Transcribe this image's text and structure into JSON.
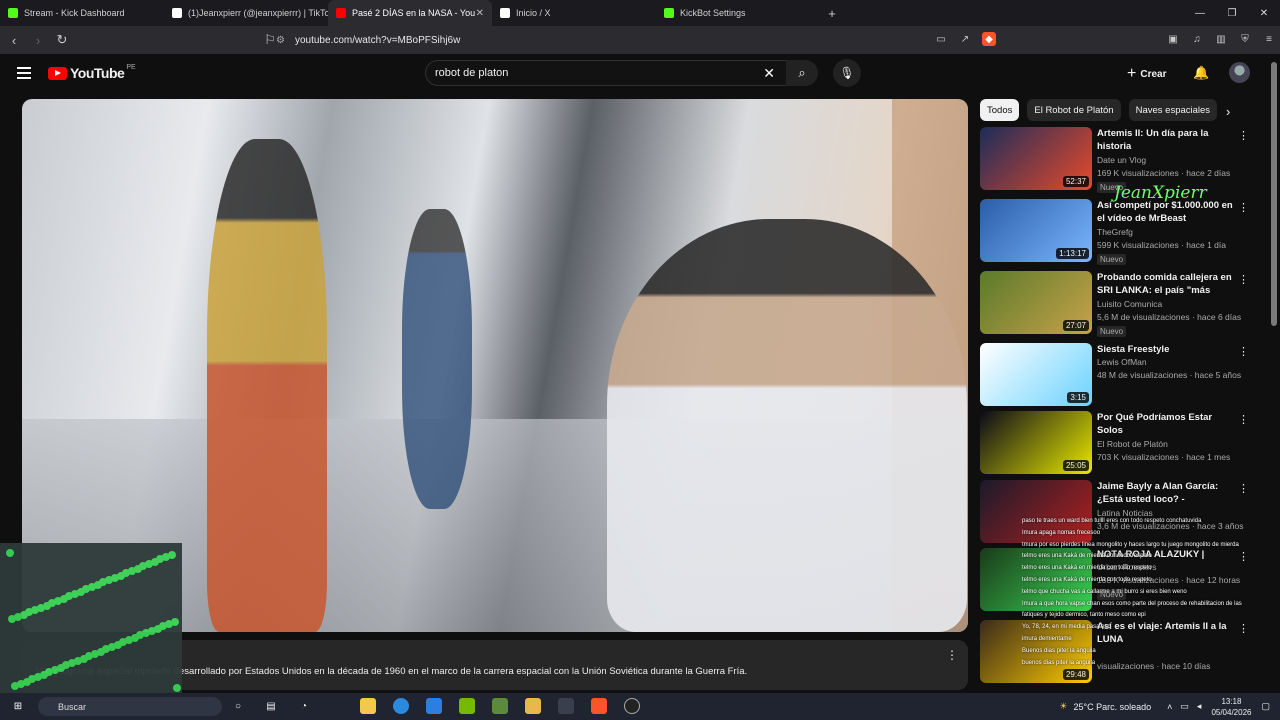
{
  "browser": {
    "tabs": [
      {
        "label": "Stream - Kick Dashboard",
        "color": "#53fc18",
        "active": false
      },
      {
        "label": "(1)Jeanxpierr (@jeanxpierrr) | TikTok",
        "color": "#ffffff",
        "active": false
      },
      {
        "label": "Pasé 2 DÍAS en la NASA - You",
        "color": "#ff0000",
        "active": true
      },
      {
        "label": "Inicio / X",
        "color": "#ffffff",
        "active": false
      },
      {
        "label": "KickBot Settings",
        "color": "#53fc18",
        "active": false
      }
    ],
    "new_tab": "+",
    "url": "youtube.com/watch?v=MBoPFSihj6w",
    "window_controls": [
      "—",
      "❐",
      "✕"
    ]
  },
  "youtube": {
    "logo_text": "YouTube",
    "country": "PE",
    "search_value": "robot de platon",
    "create_label": "Crear"
  },
  "watermark": "JeanXpierr",
  "caption": "Viki       programa espacial tripulado desarrollado por Estados Unidos en la década de 1960 en el marco de la carrera espacial con la Unión Soviética durante la Guerra Fría.",
  "chips": [
    "Todos",
    "El Robot de Platón",
    "Naves espaciales"
  ],
  "recommendations": [
    {
      "title": "Artemis II: Un día para la historia",
      "channel": "Date un Vlog",
      "meta": "169 K visualizaciones · hace 2 días",
      "badge": "Nuevo",
      "duration": "52:37",
      "colors": [
        "#1c2c5a",
        "#e84a2a"
      ]
    },
    {
      "title": "Así competí por $1.000.000 en el vídeo de MrBeast",
      "channel": "TheGrefg",
      "meta": "599 K visualizaciones · hace 1 día",
      "badge": "Nuevo",
      "duration": "1:13:17",
      "colors": [
        "#2a5da8",
        "#7bb6ff"
      ]
    },
    {
      "title": "Probando comida callejera en SRI LANKA: el país \"más barat...",
      "channel": "Luisito Comunica",
      "meta": "5,6 M de visualizaciones · hace 6 días",
      "badge": "Nuevo",
      "duration": "27:07",
      "colors": [
        "#5a7a2a",
        "#c8a24a"
      ]
    },
    {
      "title": "Siesta Freestyle",
      "channel": "Lewis OfMan",
      "meta": "48 M de visualizaciones · hace 5 años",
      "badge": "",
      "duration": "3:15",
      "colors": [
        "#ffffff",
        "#6ad2ff"
      ]
    },
    {
      "title": "Por Qué Podríamos Estar Solos",
      "channel": "El Robot de Platón",
      "meta": "703 K visualizaciones · hace 1 mes",
      "badge": "",
      "duration": "25:05",
      "colors": [
        "#0a0a1a",
        "#e8e800"
      ]
    },
    {
      "title": "Jaime Bayly a Alan García: ¿Está usted loco? - Entrevista ...",
      "channel": "Latina Noticias",
      "meta": "3,6 M de visualizaciones · hace 3 años",
      "badge": "",
      "duration": "",
      "colors": [
        "#1a1a2a",
        "#b02020"
      ]
    },
    {
      "title": "NOTA ROJA ALAZUKY |",
      "channel": "Urban Roosters",
      "meta": "108 K visualizaciones · hace 12 horas",
      "badge": "Nuevo",
      "duration": "",
      "colors": [
        "#1a3a1a",
        "#39d353"
      ]
    },
    {
      "title": "Así es el viaje: Artemis II a la LUNA",
      "channel": "",
      "meta": "visualizaciones · hace 10 días",
      "badge": "",
      "duration": "29:48",
      "colors": [
        "#3a2a1a",
        "#ffcc00"
      ]
    }
  ],
  "chat": [
    "paso te traes un ward bien tullll eres con todo respeto conchatuvida",
    "Imura apaga nomas frecesoo",
    "tmura por eso pierdes linea mongolito y haces largo tu juego mongolito de mierda",
    "telmo eres una Kaká de mierda con todo respeto",
    "telmo eres una Kaká en mierda con todo respeto",
    "telmo eres una Kaká de mierda con todo respeto",
    "telmo que chucha vas a callarme a mi burro si eres bien weno",
    "Imura a que hora vapse chan esos como parte del proceso de rehabilitacion de las fatiques y tejido dermico, tanto meso como epi",
    "Yo, 78, 24, en mi media pasa eso",
    "imura demientame",
    "Buenos dias piter la anguila",
    "buenos dias piter la anguila"
  ],
  "taskbar": {
    "search_placeholder": "Buscar",
    "weather": "25°C  Parc. soleado",
    "time": "13:18",
    "date": "05/04/2026"
  }
}
